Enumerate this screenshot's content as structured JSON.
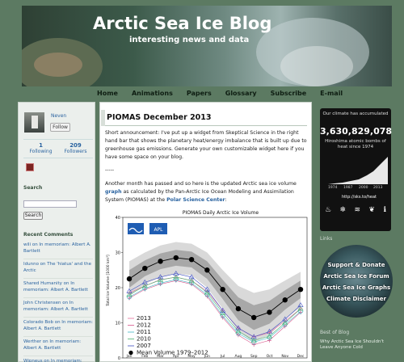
{
  "header": {
    "title": "Arctic Sea Ice Blog",
    "subtitle": "interesting news and data"
  },
  "nav": {
    "items": [
      "Home",
      "Animations",
      "Papers",
      "Glossary",
      "Subscribe",
      "E-mail"
    ]
  },
  "left": {
    "user_name": "Neven",
    "follow_label": "Follow",
    "following_count": "1",
    "following_label": "Following",
    "followers_count": "209",
    "followers_label": "Followers",
    "search_title": "Search",
    "search_button": "Search",
    "recent_title": "Recent Comments",
    "comments": [
      "wili on In memoriam: Albert A. Bartlett",
      "Idunno on The 'hiatus' and the Arctic",
      "Shared Humanity on In memoriam: Albert A. Bartlett",
      "John Christensen on In memoriam: Albert A. Bartlett",
      "Colorado Bob on In memoriam: Albert A. Bartlett",
      "Werther on In memoriam: Albert A. Bartlett",
      "Wipneus on In memoriam: Albert A. Bartlett"
    ]
  },
  "post": {
    "title": "PIOMAS December 2013",
    "para1": "Short announcement: I've put up a widget from Skeptical Science in the right hand bar that shows the planetary heat/energy imbalance that is built up due to greenhouse gas emissions. Generate your own customizable widget here if you have some space on your blog.",
    "dashes": "-----",
    "para2_a": "Another month has passed and so here is the updated Arctic sea ice volume ",
    "para2_link1": "graph",
    "para2_b": " as calculated by the Pan-Arctic Ice Ocean Modeling and Assimilation System (PIOMAS) at the ",
    "para2_link2": "Polar Science Center",
    "para2_c": ":"
  },
  "chart_data": {
    "type": "line",
    "title": "PIOMAS Daily Arctic Ice Volume",
    "ylabel": "Total Ice Volume [1000 km³]",
    "ylim": [
      0,
      40
    ],
    "yticks": [
      0,
      10,
      20,
      30,
      40
    ],
    "categories": [
      "Jan",
      "Feb",
      "Mar",
      "Apr",
      "May",
      "Jun",
      "Jul",
      "Aug",
      "Sep",
      "Oct",
      "Nov",
      "Dec"
    ],
    "series": [
      {
        "name": "Mean Volume 1979–2012",
        "values": [
          22.5,
          25.5,
          27.5,
          28.5,
          28.0,
          25.0,
          19.5,
          14.0,
          11.5,
          13.0,
          16.5,
          19.5
        ],
        "color": "#000000"
      },
      {
        "name": "2013",
        "values": [
          18.5,
          20.5,
          22.3,
          23.0,
          22.0,
          19.0,
          13.5,
          8.5,
          6.0,
          7.2,
          10.5,
          14.0
        ],
        "color": "#e36a97"
      },
      {
        "name": "2012",
        "values": [
          17.0,
          19.5,
          21.0,
          22.0,
          21.0,
          17.5,
          11.5,
          6.5,
          3.8,
          5.0,
          9.0,
          13.0
        ],
        "color": "#d7548a"
      },
      {
        "name": "2011",
        "values": [
          17.3,
          19.8,
          21.3,
          22.3,
          21.3,
          18.0,
          12.0,
          7.0,
          4.5,
          5.8,
          9.5,
          13.2
        ],
        "color": "#40b6c5"
      },
      {
        "name": "2010",
        "values": [
          18.0,
          20.5,
          22.2,
          23.0,
          22.0,
          18.6,
          12.8,
          7.6,
          5.0,
          6.2,
          10.0,
          14.0
        ],
        "color": "#4bb06f"
      },
      {
        "name": "2007",
        "values": [
          19.0,
          21.5,
          23.0,
          24.0,
          23.0,
          19.5,
          13.5,
          8.5,
          6.0,
          7.5,
          11.0,
          15.0
        ],
        "color": "#3f4ec2"
      }
    ],
    "band_2sd": {
      "upper": [
        27.5,
        30.0,
        32.0,
        33.0,
        32.5,
        30.0,
        25.0,
        20.5,
        18.5,
        19.5,
        22.0,
        24.5
      ],
      "lower": [
        17.5,
        21.0,
        23.0,
        24.0,
        23.5,
        20.0,
        14.0,
        7.5,
        4.5,
        6.5,
        11.0,
        14.5
      ]
    }
  },
  "widget": {
    "top_text": "Our climate has accumulated",
    "number": "3,630,829,078",
    "sub_text": "Hiroshima atomic bombs of heat since 1974",
    "axis_label": "Billion A-Bombs",
    "years": [
      "1974",
      "1987",
      "2000",
      "2013"
    ],
    "url": "http://sks.to/heat"
  },
  "right": {
    "links_title": "Links",
    "links": [
      "Support & Donate",
      "Arctic Sea Ice Forum",
      "Arctic Sea Ice Graphs",
      "Climate Disclaimer"
    ],
    "best_title": "Best of Blog",
    "best_item1": "Why Arctic Sea Ice Shouldn't Leave Anyone Cold",
    "best_item2": ""
  }
}
